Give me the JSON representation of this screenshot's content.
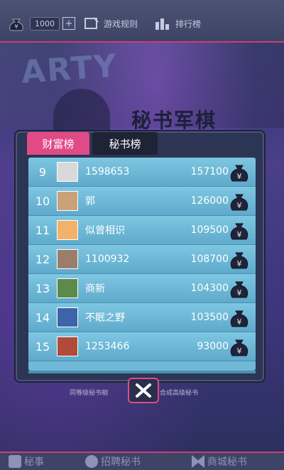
{
  "topbar": {
    "coins": "1000",
    "plus": "+",
    "rules_label": "游戏规则",
    "leaderboard_label": "排行榜"
  },
  "background": {
    "party_text": "ARTY",
    "banner_text": "秘书军棋"
  },
  "tabs": {
    "wealth": "财富榜",
    "secretary": "秘书榜",
    "active": "wealth"
  },
  "ranking": [
    {
      "rank": "9",
      "name": "1598653",
      "score": "157100",
      "avatar_color": "#d9d9d9"
    },
    {
      "rank": "10",
      "name": "郭",
      "score": "126000",
      "avatar_color": "#c9a27a"
    },
    {
      "rank": "11",
      "name": "似曾相识",
      "score": "109500",
      "avatar_color": "#f2b26a"
    },
    {
      "rank": "12",
      "name": "1100932",
      "score": "108700",
      "avatar_color": "#9a7d6a"
    },
    {
      "rank": "13",
      "name": "商新",
      "score": "104300",
      "avatar_color": "#5b8a4a"
    },
    {
      "rank": "14",
      "name": "不眠之野",
      "score": "103500",
      "avatar_color": "#3d63a8"
    },
    {
      "rank": "15",
      "name": "1253466",
      "score": "93000",
      "avatar_color": "#b04a3a"
    }
  ],
  "hint": {
    "left": "同等级秘书相",
    "right": "合成高级秘书"
  },
  "bottom_nav": [
    {
      "label": "秘事"
    },
    {
      "label": "招聘秘书"
    },
    {
      "label": "商城秘书"
    }
  ],
  "colors": {
    "accent": "#e04a86",
    "list_bg": "#6fb8d6"
  }
}
